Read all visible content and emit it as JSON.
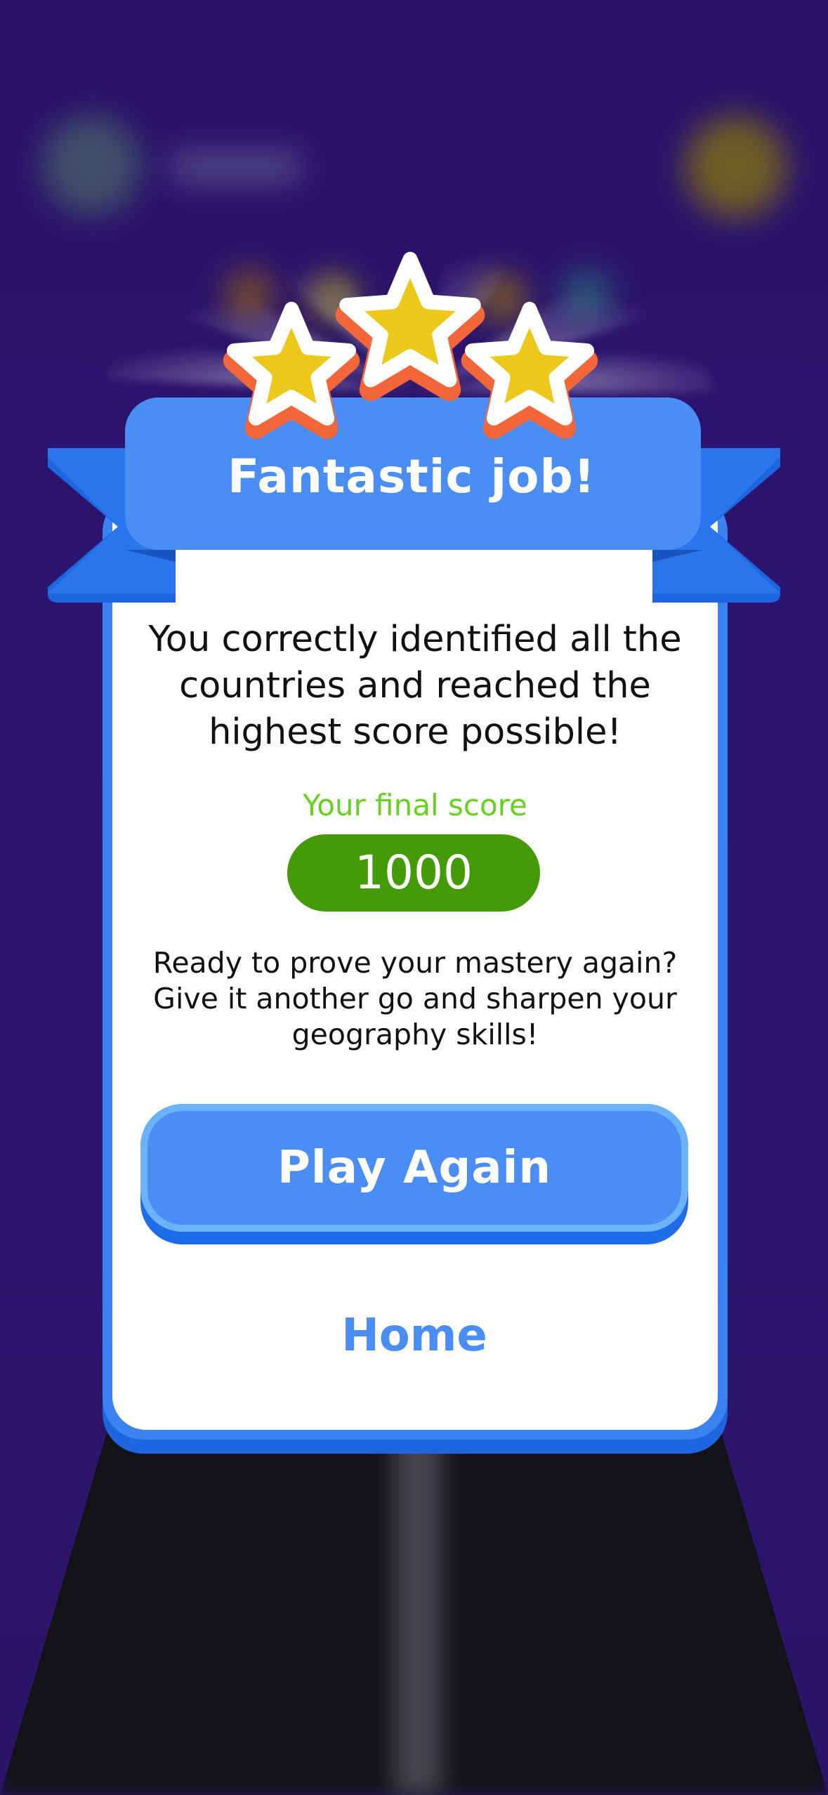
{
  "result": {
    "title": "Fantastic job!",
    "stars_earned": 3,
    "stars_total": 3,
    "message": "You correctly identified all the countries and reached the highest score possible!",
    "score_label": "Your final score",
    "score_value": "1000",
    "sub_message": "Ready to prove your mastery again? Give it another go and sharpen your geography skills!"
  },
  "actions": {
    "play_again_label": "Play Again",
    "home_label": "Home"
  },
  "colors": {
    "background": "#2a1466",
    "card_blue": "#3b82f0",
    "ribbon_blue": "#4a8ef5",
    "star_yellow": "#ecc81a",
    "star_outline_orange": "#f2663a",
    "score_green": "#459a07",
    "score_label_green": "#66d11f"
  },
  "icons": [
    "star-icon"
  ]
}
